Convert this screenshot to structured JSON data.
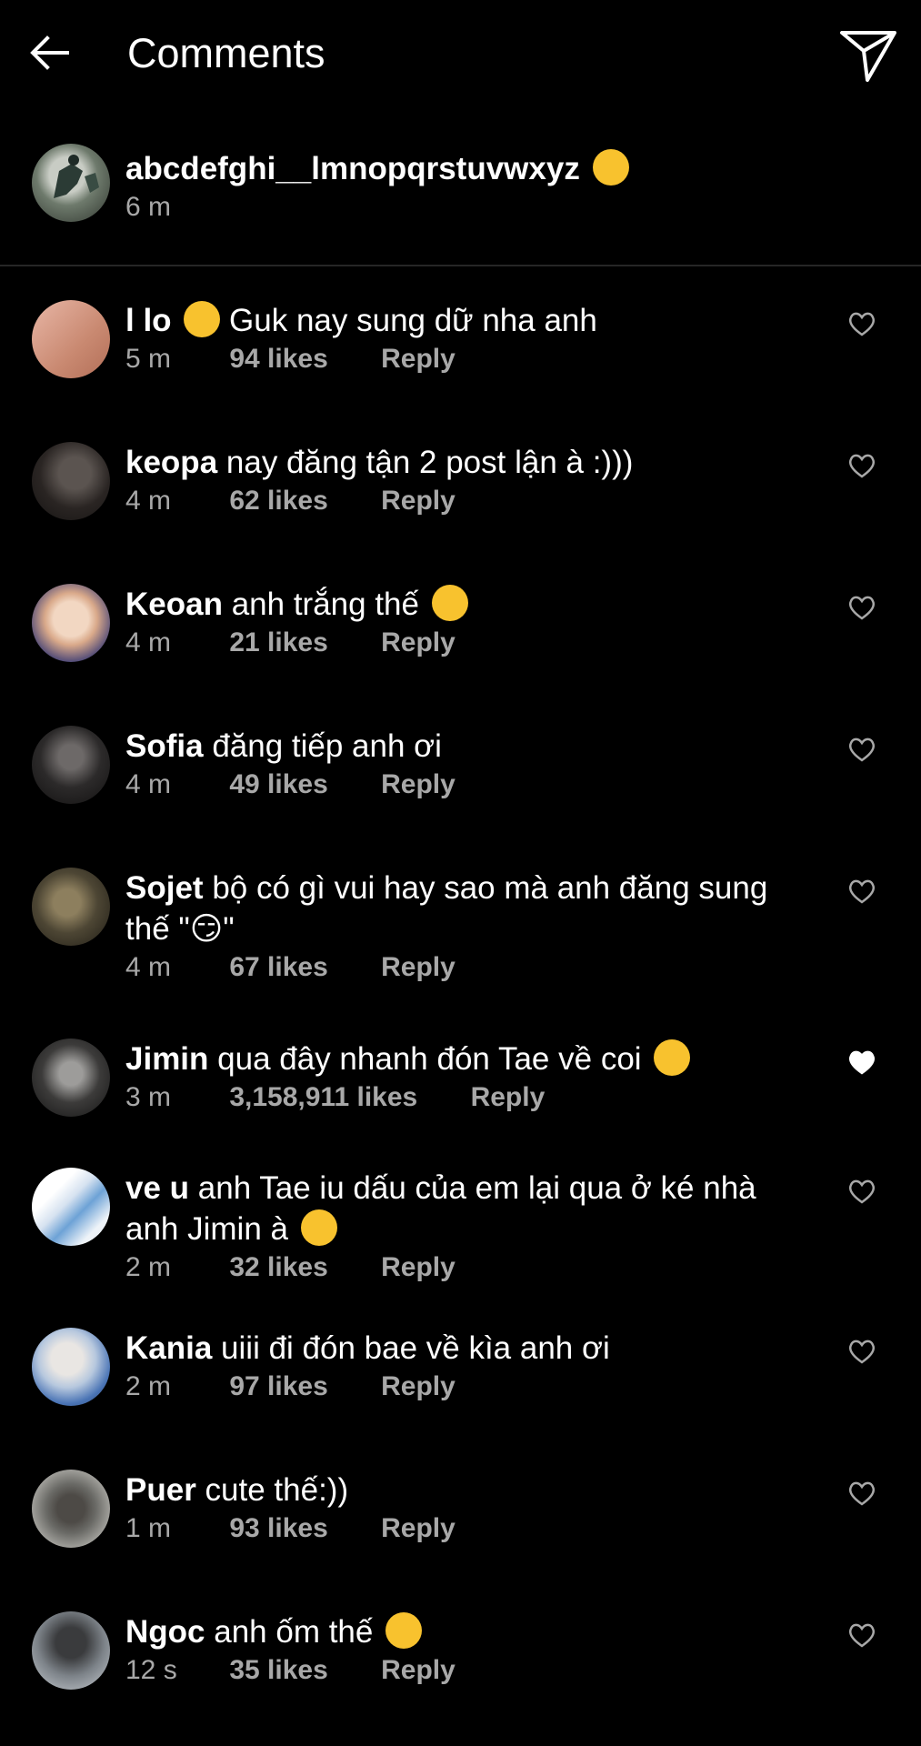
{
  "header": {
    "title": "Comments",
    "icons": {
      "back": "arrow-left-icon",
      "send": "paper-plane-icon"
    }
  },
  "caption": {
    "username": "abcdefghi__lmnopqrstuvwxyz",
    "emoji": "😚",
    "time": "6 m"
  },
  "comments": [
    {
      "user": "l lo",
      "emoji_before": "😘",
      "text": "Guk nay sung dữ nha anh",
      "time": "5 m",
      "likes": "94 likes",
      "reply": "Reply",
      "liked": false
    },
    {
      "user": "keopa",
      "text": "nay đăng tận 2 post lận à :)))",
      "time": "4 m",
      "likes": "62 likes",
      "reply": "Reply",
      "liked": false
    },
    {
      "user": "Keoan",
      "text": "anh trắng thế",
      "emoji_after": "🥺",
      "time": "4 m",
      "likes": "21 likes",
      "reply": "Reply",
      "liked": false
    },
    {
      "user": "Sofia",
      "text": "đăng tiếp anh ơi",
      "time": "4 m",
      "likes": "49 likes",
      "reply": "Reply",
      "liked": false
    },
    {
      "user": "Sojet",
      "text": "bộ có gì vui hay sao mà anh đăng sung thế \"😏\"",
      "time": "4 m",
      "likes": "67 likes",
      "reply": "Reply",
      "liked": false
    },
    {
      "user": "Jimin",
      "text": "qua đây nhanh đón Tae về coi",
      "emoji_after": "😤",
      "time": "3 m",
      "likes": "3,158,911 likes",
      "reply": "Reply",
      "liked": true
    },
    {
      "user": "ve u",
      "text": "anh Tae iu dấu của em lại qua ở ké nhà anh Jimin à",
      "emoji_after": "🤭",
      "time": "2 m",
      "likes": "32 likes",
      "reply": "Reply",
      "liked": false
    },
    {
      "user": "Kania",
      "text": "uiii đi đón bae về kìa anh ơi",
      "time": "2 m",
      "likes": "97 likes",
      "reply": "Reply",
      "liked": false
    },
    {
      "user": "Puer",
      "text": "cute thế:))",
      "time": "1 m",
      "likes": "93 likes",
      "reply": "Reply",
      "liked": false
    },
    {
      "user": "Ngoc",
      "text": "anh ốm thế",
      "emoji_after": "🥺",
      "time": "12 s",
      "likes": "35 likes",
      "reply": "Reply",
      "liked": false
    }
  ],
  "colors": {
    "background": "#000000",
    "text_primary": "#ffffff",
    "text_secondary": "#a8a8a8",
    "divider": "#262626"
  }
}
